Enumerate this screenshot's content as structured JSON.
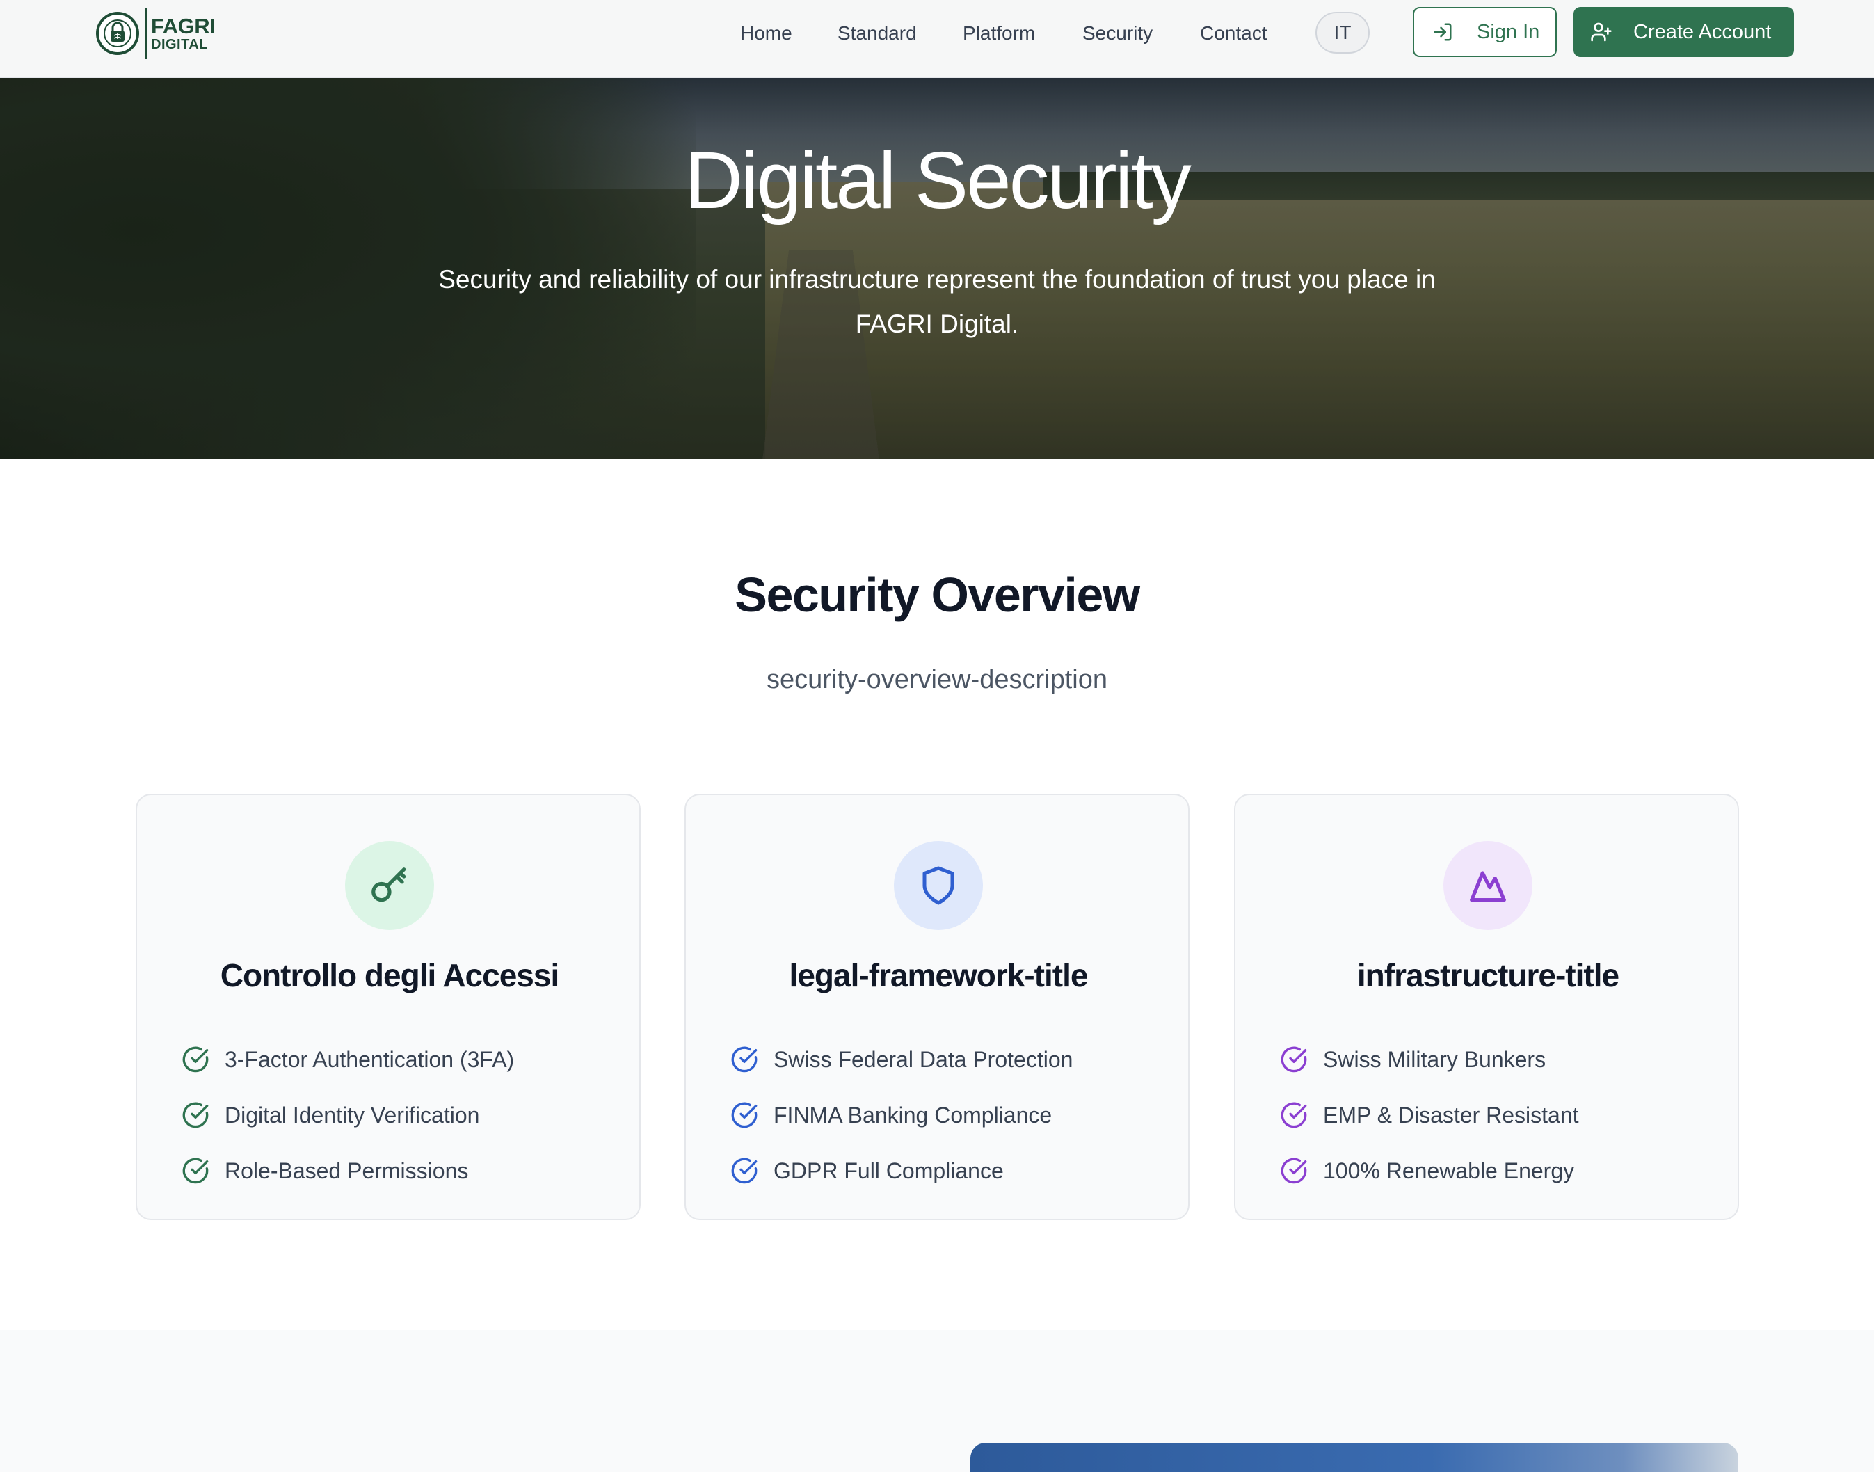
{
  "brand": {
    "line1": "FAGRI",
    "line2": "DIGITAL"
  },
  "nav": {
    "items": [
      "Home",
      "Standard",
      "Platform",
      "Security",
      "Contact"
    ],
    "lang": "IT",
    "sign_in": "Sign In",
    "create_account": "Create Account"
  },
  "hero": {
    "title": "Digital Security",
    "subtitle": "Security and reliability of our infrastructure represent the foundation of trust you place in FAGRI Digital."
  },
  "overview": {
    "title": "Security Overview",
    "description": "security-overview-description",
    "cards": [
      {
        "icon": "key-icon",
        "accent": "#2f7350",
        "icon_bg": "#dcf5e6",
        "title": "Controllo degli Accessi",
        "items": [
          "3-Factor Authentication (3FA)",
          "Digital Identity Verification",
          "Role-Based Permissions"
        ]
      },
      {
        "icon": "shield-icon",
        "accent": "#2f5fd0",
        "icon_bg": "#dfe8fb",
        "title": "legal-framework-title",
        "items": [
          "Swiss Federal Data Protection",
          "FINMA Banking Compliance",
          "GDPR Full Compliance"
        ]
      },
      {
        "icon": "mountain-icon",
        "accent": "#8b3fd1",
        "icon_bg": "#f1e6fb",
        "title": "infrastructure-title",
        "items": [
          "Swiss Military Bunkers",
          "EMP & Disaster Resistant",
          "100% Renewable Energy"
        ]
      }
    ]
  },
  "colors": {
    "brand_green": "#2f7350",
    "nav_bg": "#f6f7f7"
  }
}
